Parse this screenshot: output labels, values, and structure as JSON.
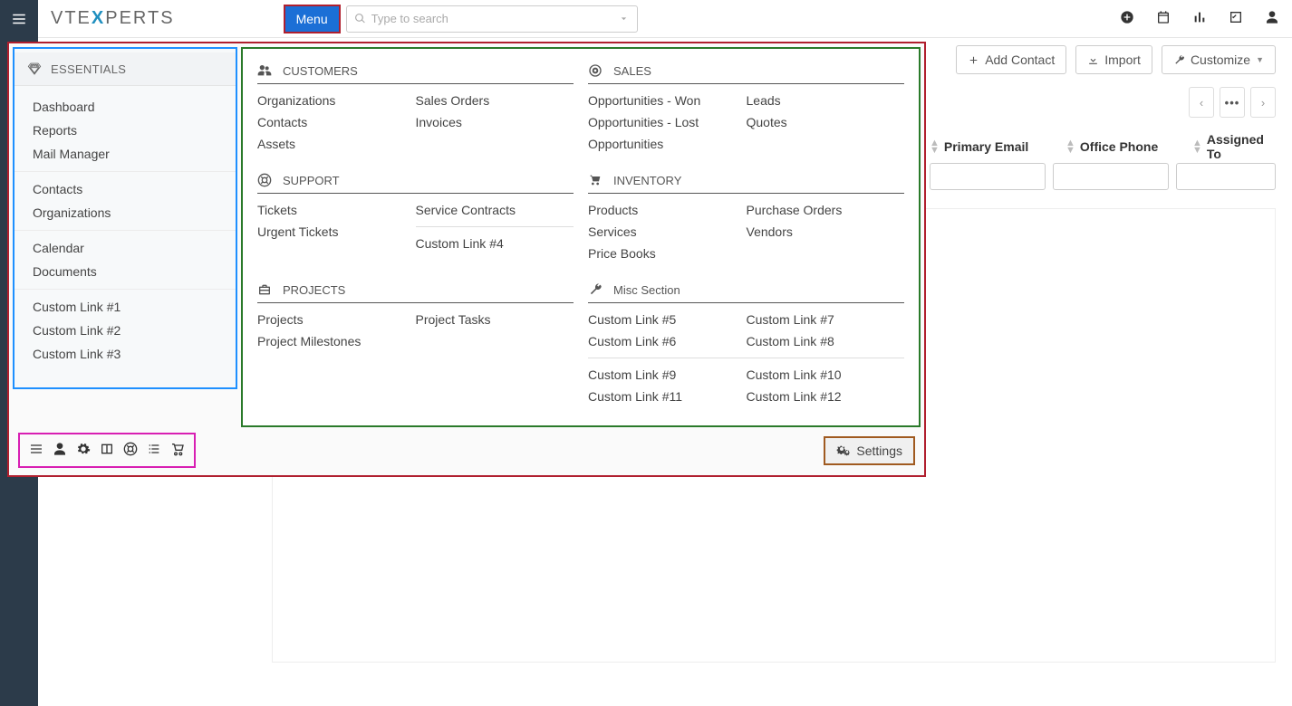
{
  "header": {
    "logo_plain": "VTE",
    "logo_accent": "X",
    "logo_suffix": "PERTS",
    "menu_label": "Menu",
    "search_placeholder": "Type to search"
  },
  "top_icons": {
    "add": "plus",
    "calendar": "calendar",
    "chart": "bar-chart",
    "checklist": "checklist",
    "user": "user"
  },
  "actions": {
    "add_contact": "Add Contact",
    "import": "Import",
    "customize": "Customize"
  },
  "columns": {
    "primary_email": "Primary Email",
    "office_phone": "Office Phone",
    "assigned_to": "Assigned To"
  },
  "menu": {
    "essentials": {
      "title": "ESSENTIALS",
      "group1": [
        "Dashboard",
        "Reports",
        "Mail Manager"
      ],
      "group2": [
        "Contacts",
        "Organizations"
      ],
      "group3": [
        "Calendar",
        "Documents"
      ],
      "group4": [
        "Custom Link #1",
        "Custom Link #2",
        "Custom Link #3"
      ]
    },
    "sections": [
      {
        "title": "CUSTOMERS",
        "icon": "users",
        "col1": [
          "Organizations",
          "Contacts",
          "Assets"
        ],
        "col2": [
          "Sales Orders",
          "Invoices"
        ]
      },
      {
        "title": "SALES",
        "icon": "target",
        "col1": [
          "Opportunities - Won",
          "Opportunities - Lost",
          "Opportunities"
        ],
        "col2": [
          "Leads",
          "Quotes"
        ]
      },
      {
        "title": "SUPPORT",
        "icon": "lifebuoy",
        "col1": [
          "Tickets",
          "Urgent Tickets"
        ],
        "col2": [
          "Service Contracts"
        ],
        "col2b": [
          "Custom Link #4"
        ]
      },
      {
        "title": "INVENTORY",
        "icon": "trolley",
        "col1": [
          "Products",
          "Services",
          "Price Books"
        ],
        "col2": [
          "Purchase Orders",
          "Vendors"
        ]
      },
      {
        "title": "PROJECTS",
        "icon": "briefcase",
        "col1": [
          "Projects",
          "Project Milestones"
        ],
        "col2": [
          "Project Tasks"
        ]
      },
      {
        "title": "Misc Section",
        "icon": "wrench",
        "col1": [
          "Custom Link #5",
          "Custom Link #6"
        ],
        "col2": [
          "Custom Link #7",
          "Custom Link #8"
        ],
        "col1b": [
          "Custom Link #9",
          "Custom Link #11"
        ],
        "col2b": [
          "Custom Link #10",
          "Custom Link #12"
        ]
      }
    ],
    "settings_label": "Settings"
  }
}
